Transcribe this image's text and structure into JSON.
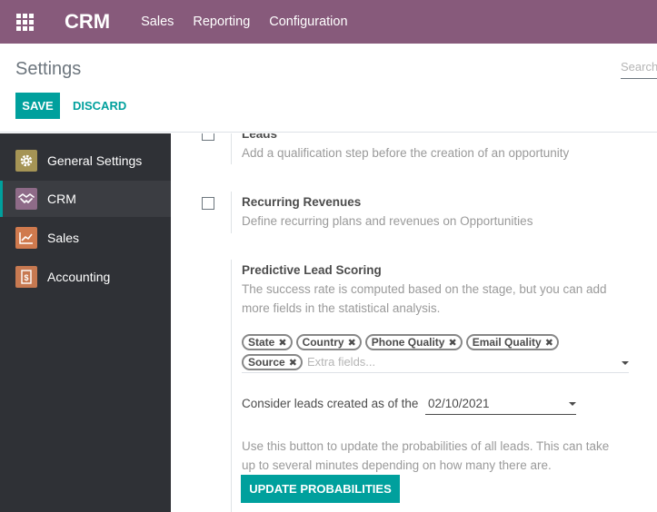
{
  "navbar": {
    "brand": "CRM",
    "menu": [
      "Sales",
      "Reporting",
      "Configuration"
    ],
    "color": "#875a7b"
  },
  "control_panel": {
    "title": "Settings",
    "search_placeholder": "Search...",
    "save_label": "SAVE",
    "discard_label": "DISCARD"
  },
  "sidebar": {
    "items": [
      {
        "label": "General Settings",
        "icon": "gear-icon",
        "active": false
      },
      {
        "label": "CRM",
        "icon": "handshake-icon",
        "active": true
      },
      {
        "label": "Sales",
        "icon": "chart-line-icon",
        "active": false
      },
      {
        "label": "Accounting",
        "icon": "invoice-icon",
        "active": false
      }
    ]
  },
  "settings": {
    "leads": {
      "title": "Leads",
      "description": "Add a qualification step before the creation of an opportunity",
      "checked": false
    },
    "recurring": {
      "title": "Recurring Revenues",
      "description": "Define recurring plans and revenues on Opportunities",
      "checked": false
    },
    "pls": {
      "title": "Predictive Lead Scoring",
      "description_line1": "The success rate is computed based on the stage, but you can add",
      "description_line2": "more fields in the statistical analysis.",
      "tags": [
        "State",
        "Country",
        "Phone Quality",
        "Email Quality",
        "Source"
      ],
      "extra_placeholder": "Extra fields...",
      "date_label": "Consider leads created as of the",
      "date_value": "02/10/2021",
      "update_help_line1": "Use this button to update the probabilities of all leads. This can take",
      "update_help_line2": "up to several minutes depending on how many there are.",
      "update_button": "UPDATE PROBABILITIES"
    }
  },
  "colors": {
    "accent": "#00a09d",
    "sidebar_bg": "#2f3136"
  }
}
